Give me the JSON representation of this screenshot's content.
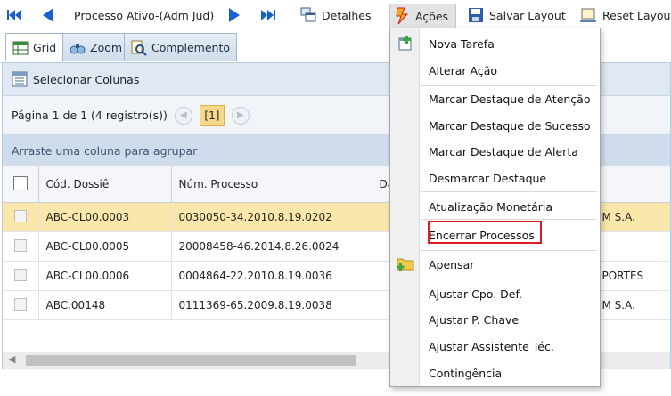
{
  "toolbar": {
    "first_icon": "skip-first-icon",
    "prev_icon": "arrow-left-icon",
    "title": "Processo Ativo-(Adm Jud)",
    "next_icon": "arrow-right-icon",
    "last_icon": "skip-last-icon",
    "detalhes": "Detalhes",
    "acoes": "Ações",
    "salvar_layout": "Salvar Layout",
    "reset_layout": "Reset Layout"
  },
  "tabs": [
    {
      "label": "Grid",
      "icon": "grid-icon"
    },
    {
      "label": "Zoom",
      "icon": "binoculars-icon"
    },
    {
      "label": "Complemento",
      "icon": "search-document-icon"
    }
  ],
  "columns_bar": {
    "label": "Selecionar Colunas"
  },
  "pager": {
    "text": "Página 1 de 1 (4 registro(s))",
    "current": "[1]"
  },
  "group_hint": "Arraste uma coluna para agrupar",
  "grid": {
    "headers": [
      "Cód. Dossiê",
      "Núm. Processo",
      "Da"
    ],
    "rows": [
      {
        "dossie": "ABC-CL00.0003",
        "processo": "0030050-34.2010.8.19.0202",
        "extra": "M S.A.",
        "selected": true
      },
      {
        "dossie": "ABC-CL00.0005",
        "processo": "20008458-46.2014.8.26.0024",
        "extra": "",
        "selected": false
      },
      {
        "dossie": "ABC-CL00.0006",
        "processo": "0004864-22.2010.8.19.0036",
        "extra": "PORTES",
        "selected": false
      },
      {
        "dossie": "ABC.00148",
        "processo": "0111369-65.2009.8.19.0038",
        "extra": "M S.A.",
        "selected": false
      }
    ]
  },
  "menu": {
    "items": [
      "Nova Tarefa",
      "Alterar Ação",
      "Marcar Destaque de Atenção",
      "Marcar Destaque de Sucesso",
      "Marcar Destaque de Alerta",
      "Desmarcar Destaque",
      "Atualização Monetária",
      "Encerrar Processos",
      "Apensar",
      "Ajustar Cpo. Def.",
      "Ajustar P. Chave",
      "Ajustar Assistente Téc.",
      "Contingência"
    ],
    "highlighted": "Encerrar Processos"
  },
  "colors": {
    "accent": "#1a5fd0",
    "selected_row": "#fbe7a9",
    "highlight_border": "#e01a22"
  }
}
